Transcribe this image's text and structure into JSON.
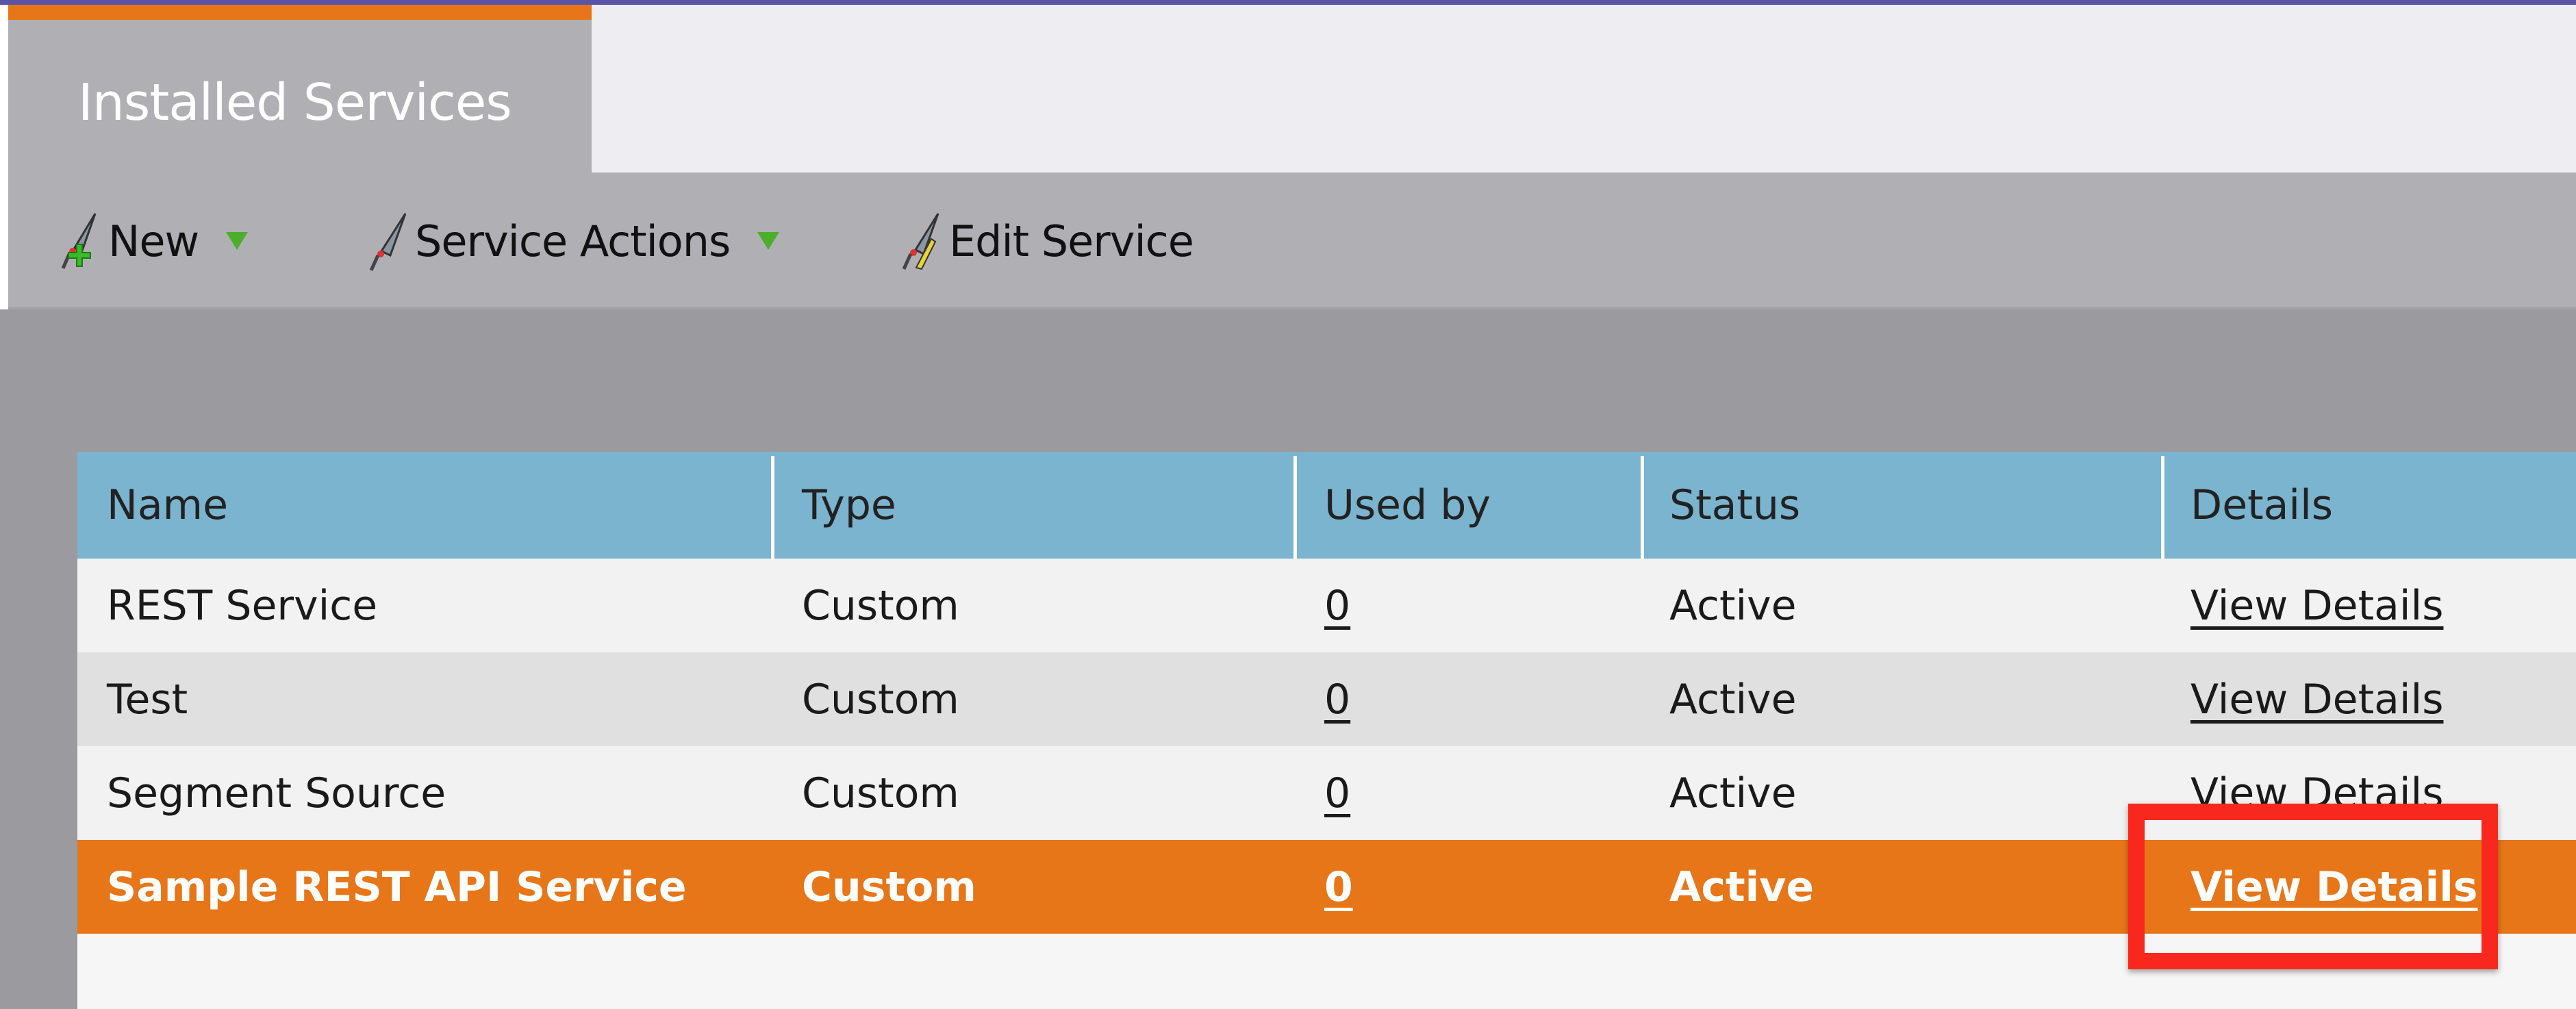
{
  "tab": {
    "title": "Installed Services",
    "accent_color": "#e77619"
  },
  "toolbar": {
    "new_label": "New",
    "new_icon": "rocket-plus-icon",
    "actions_label": "Service Actions",
    "actions_icon": "rocket-icon",
    "edit_label": "Edit Service",
    "edit_icon": "rocket-pencil-icon"
  },
  "table": {
    "headers": [
      "Name",
      "Type",
      "Used by",
      "Status",
      "Details"
    ],
    "rows": [
      {
        "name": "REST Service",
        "type": "Custom",
        "used_by": "0",
        "status": "Active",
        "details": "View Details"
      },
      {
        "name": "Test",
        "type": "Custom",
        "used_by": "0",
        "status": "Active",
        "details": "View Details"
      },
      {
        "name": "Segment Source",
        "type": "Custom",
        "used_by": "0",
        "status": "Active",
        "details": "View Details"
      },
      {
        "name": "Sample REST API Service",
        "type": "Custom",
        "used_by": "0",
        "status": "Active",
        "details": "View Details",
        "selected": true
      }
    ],
    "header_color": "#7ab4cf",
    "selected_color": "#e77619"
  },
  "annotation": {
    "highlight_color": "#f9281e"
  }
}
